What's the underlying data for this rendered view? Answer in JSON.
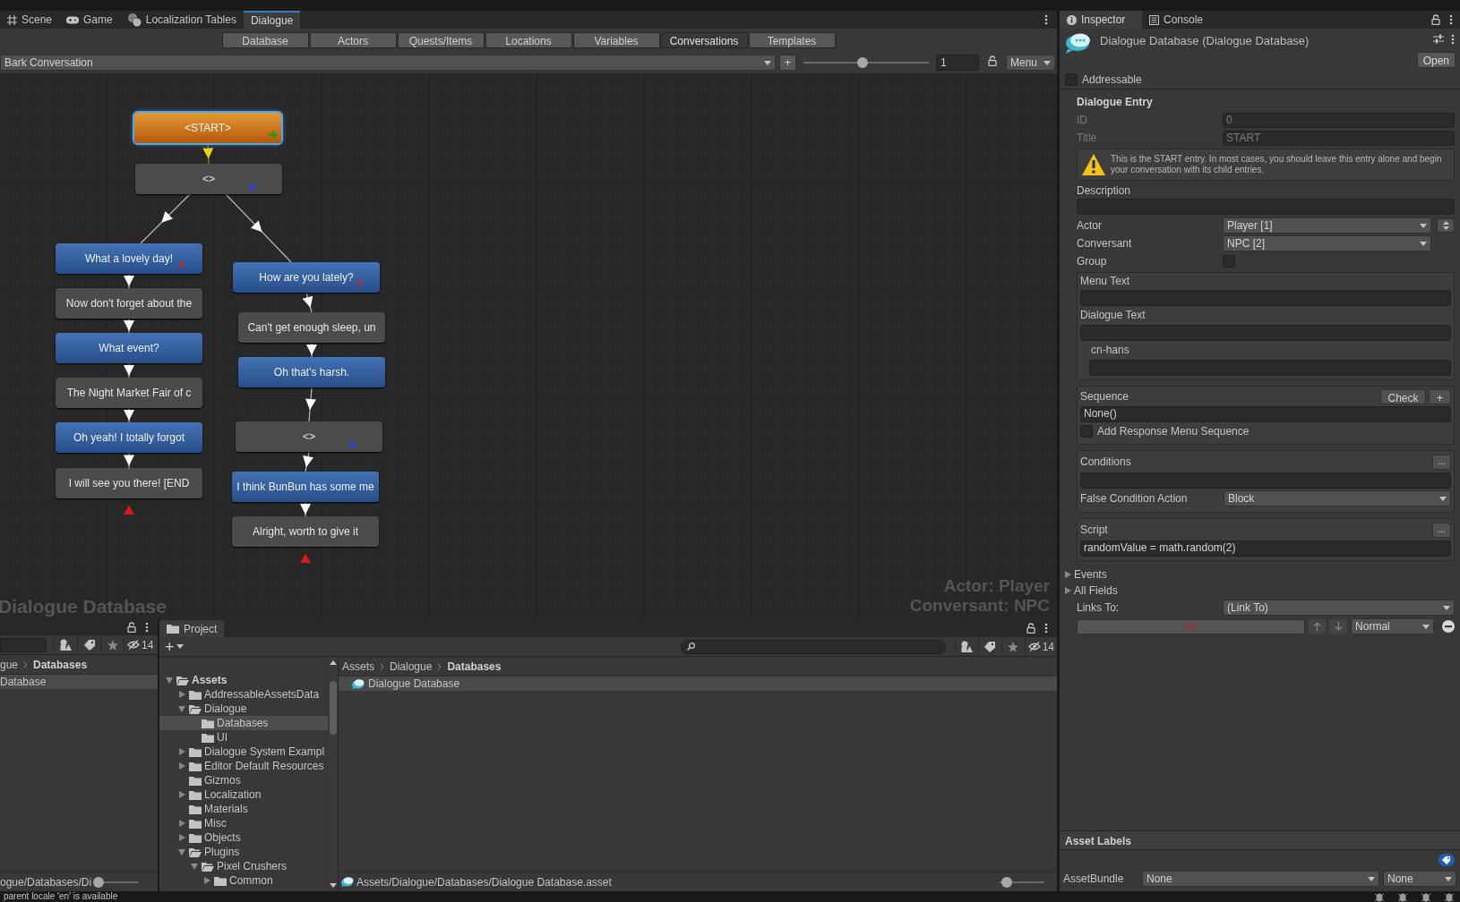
{
  "editor_tabs": [
    {
      "label": "Scene",
      "selected": false
    },
    {
      "label": "Game",
      "selected": false
    },
    {
      "label": "Localization Tables",
      "selected": false
    },
    {
      "label": "Dialogue",
      "selected": true
    }
  ],
  "dialogue_tabs": [
    {
      "label": "Database",
      "selected": false
    },
    {
      "label": "Actors",
      "selected": false
    },
    {
      "label": "Quests/Items",
      "selected": false
    },
    {
      "label": "Locations",
      "selected": false
    },
    {
      "label": "Variables",
      "selected": false
    },
    {
      "label": "Conversations",
      "selected": true
    },
    {
      "label": "Templates",
      "selected": false
    }
  ],
  "conversation_bar": {
    "conversation": "Bark Conversation",
    "add_button": "+",
    "zoom": {
      "level": 0.47
    },
    "value": "1",
    "menu": "Menu"
  },
  "canvas": {
    "nodes": [
      {
        "text": "<START>",
        "kind": "start",
        "selected": true,
        "children": [
          {
            "text": "<>",
            "kind": "group",
            "selected": false,
            "children": [
              {
                "text": "What a lovely day!",
                "kind": "player",
                "badge": "?",
                "selected": false,
                "children": [
                  {
                    "text": "Now don't forget about the",
                    "kind": "npc",
                    "selected": false,
                    "children": [
                      {
                        "text": "What event?",
                        "kind": "player",
                        "selected": false,
                        "children": [
                          {
                            "text": "The Night Market Fair of c",
                            "kind": "npc",
                            "selected": false,
                            "children": [
                              {
                                "text": "Oh yeah!  I totally forgot",
                                "kind": "player",
                                "selected": false,
                                "children": [
                                  {
                                    "text": "I will see you there! [END",
                                    "kind": "npc",
                                    "selected": false
                                  }
                                ]
                              }
                            ]
                          }
                        ]
                      }
                    ]
                  }
                ]
              },
              {
                "text": "How are you lately?",
                "kind": "player",
                "badge": "?",
                "selected": false,
                "children": [
                  {
                    "text": "Can't get enough sleep, un",
                    "kind": "npc",
                    "selected": false,
                    "children": [
                      {
                        "text": "Oh that's harsh.",
                        "kind": "player",
                        "selected": false,
                        "children": [
                          {
                            "text": "<>",
                            "kind": "group",
                            "selected": false,
                            "children": [
                              {
                                "text": "I think BunBun has some me",
                                "kind": "player",
                                "selected": false,
                                "children": [
                                  {
                                    "text": "Alright, worth to give it",
                                    "kind": "npc",
                                    "selected": false
                                  }
                                ]
                              }
                            ]
                          }
                        ]
                      }
                    ]
                  }
                ]
              }
            ]
          }
        ]
      }
    ],
    "database_label": "Dialogue Database",
    "actor_label": "Actor: Player",
    "conversant_label": "Conversant: NPC"
  },
  "bottom_left": {
    "search_count": "14",
    "breadcrumb": [
      "gue",
      "Databases"
    ],
    "item": "Database",
    "path": "ogue/Databases/Di",
    "slider": {
      "level": 0
    }
  },
  "project": {
    "tab": "Project",
    "add_button": "+",
    "search_count": "14",
    "tree": [
      {
        "label": "Assets",
        "expanded": true,
        "selected": false,
        "children": [
          {
            "label": "AddressableAssetsData",
            "expanded": false,
            "selected": false
          },
          {
            "label": "Dialogue",
            "expanded": true,
            "selected": false,
            "children": [
              {
                "label": "Databases",
                "selected": true
              },
              {
                "label": "UI",
                "selected": false
              }
            ]
          },
          {
            "label": "Dialogue System Exampl",
            "expanded": false,
            "selected": false
          },
          {
            "label": "Editor Default Resources",
            "expanded": false,
            "selected": false
          },
          {
            "label": "Gizmos",
            "selected": false
          },
          {
            "label": "Localization",
            "expanded": false,
            "selected": false
          },
          {
            "label": "Materials",
            "selected": false
          },
          {
            "label": "Misc",
            "expanded": false,
            "selected": false
          },
          {
            "label": "Objects",
            "expanded": false,
            "selected": false
          },
          {
            "label": "Plugins",
            "expanded": true,
            "selected": false,
            "children": [
              {
                "label": "Pixel Crushers",
                "expanded": true,
                "selected": false,
                "children": [
                  {
                    "label": "Common",
                    "expanded": false,
                    "selected": false
                  }
                ]
              }
            ]
          }
        ]
      }
    ],
    "breadcrumb": [
      "Assets",
      "Dialogue",
      "Databases"
    ],
    "items": [
      {
        "label": "Dialogue Database",
        "selected": true
      }
    ],
    "path": "Assets/Dialogue/Databases/Dialogue Database.asset",
    "slider": {
      "level": 0.06
    }
  },
  "inspector": {
    "tabs": [
      {
        "label": "Inspector",
        "selected": true
      },
      {
        "label": "Console",
        "selected": false
      }
    ],
    "title": "Dialogue Database (Dialogue Database)",
    "open_button": "Open",
    "addressable": {
      "label": "Addressable",
      "checked": false
    },
    "entry_heading": "Dialogue Entry",
    "id": {
      "label": "ID",
      "value": "0",
      "disabled": true
    },
    "title_field": {
      "label": "Title",
      "value": "START",
      "disabled": true
    },
    "warning": "This is the START entry. In most cases, you should leave this entry alone and begin your conversation with its child entries.",
    "description": {
      "label": "Description"
    },
    "actor": {
      "label": "Actor",
      "value": "Player [1]"
    },
    "conversant": {
      "label": "Conversant",
      "value": "NPC [2]"
    },
    "group": {
      "label": "Group",
      "checked": false
    },
    "menu_text": {
      "label": "Menu Text"
    },
    "dialogue_text": {
      "label": "Dialogue Text"
    },
    "localized": {
      "label": "cn-hans"
    },
    "sequence": {
      "label": "Sequence",
      "check_button": "Check",
      "add_button": "+",
      "value": "None()",
      "response_menu": {
        "label": "Add Response Menu Sequence",
        "checked": false
      }
    },
    "conditions": {
      "label": "Conditions",
      "more_button": "...",
      "false_action_label": "False Condition Action",
      "false_action": "Block"
    },
    "script": {
      "label": "Script",
      "more_button": "...",
      "value": "randomValue = math.random(2)"
    },
    "foldouts": [
      {
        "label": "Events",
        "expanded": false
      },
      {
        "label": "All Fields",
        "expanded": false
      }
    ],
    "links": {
      "label": "Links To:",
      "value": "(Link To)",
      "target": "<>",
      "priority": "Normal"
    },
    "asset_labels": {
      "heading": "Asset Labels",
      "bundle_label": "AssetBundle",
      "bundle": "None",
      "variant": "None"
    }
  },
  "status": "parent locale 'en' is available"
}
